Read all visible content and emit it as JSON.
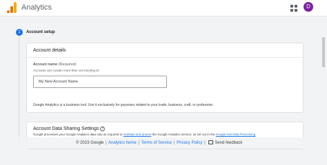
{
  "header": {
    "app_title": "Analytics",
    "logo_icon": "analytics-logo",
    "apps_icon": "apps-grid-icon",
    "avatar_initial": "D",
    "colors": {
      "logo_orange": "#f9ab00",
      "logo_dark_orange": "#e37400",
      "avatar_bg": "#7b1fa2"
    }
  },
  "stepper": {
    "step_number": "1",
    "step_label": "Account setup",
    "accent": "#1a73e8"
  },
  "account_details": {
    "title": "Account details",
    "field_label": "Account name",
    "field_required": "(Required)",
    "field_hint": "Accounts can contain more than one tracking ID",
    "input_value": "",
    "input_placeholder": "My New Account Name",
    "note": "Google Analytics is a business tool. Use it exclusively for purposes related to your trade, business, craft, or profession."
  },
  "data_sharing": {
    "title": "Account Data Sharing Settings",
    "help_icon": "help-circle-icon",
    "desc_prefix": "Google processes your Google Analytics data only as required to ",
    "desc_link1": "maintain and protect",
    "desc_middle": " the Google Analytics service, as set out in the ",
    "desc_link2": "Google Ads Data Processing"
  },
  "footer": {
    "copyright": "© 2023 Google",
    "sep": "|",
    "analytics_home": "Analytics home",
    "terms": "Terms of Service",
    "privacy": "Privacy Policy",
    "feedback": "Send feedback",
    "feedback_icon": "feedback-icon"
  }
}
